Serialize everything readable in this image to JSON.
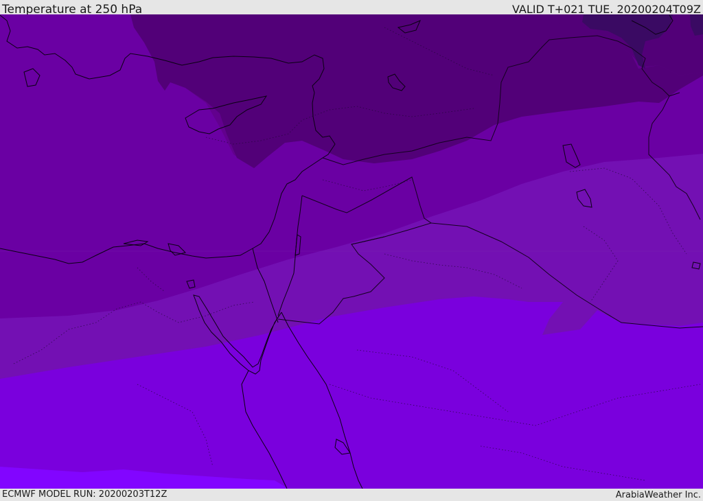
{
  "header": {
    "title": "Temperature at 250 hPa",
    "valid": "VALID T+021 TUE. 20200204T09Z"
  },
  "footer": {
    "model_run": "ECMWF MODEL RUN: 20200203T12Z",
    "credit": "ArabiaWeather Inc."
  },
  "map": {
    "field": "temperature",
    "level": "250 hPa",
    "colors": {
      "coldest": "#3a0a63",
      "very_cold": "#520078",
      "cold": "#62008e",
      "cool": "#6a00a3",
      "mild": "#7310b3",
      "warm": "#7a00dd",
      "warmest": "#8205ff",
      "coastline": "#000000",
      "border": "#1a0d26"
    }
  }
}
